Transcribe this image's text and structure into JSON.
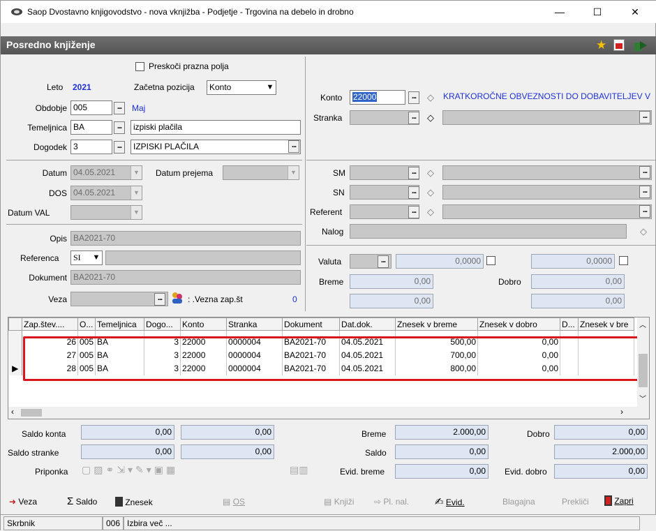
{
  "window": {
    "title": "Saop Dvostavno knjigovodstvo - nova vknjižba - Podjetje - Trgovina na debelo in drobno",
    "minimize": "—",
    "maximize": "☐",
    "close": "✕"
  },
  "header": {
    "title": "Posredno knjiženje"
  },
  "top_left": {
    "skip_empty_label": "Preskoči prazna polja",
    "year_label": "Leto",
    "year_value": "2021",
    "start_pos_label": "Začetna pozicija",
    "start_pos_value": "Konto",
    "period_label": "Obdobje",
    "period_value": "005",
    "period_name": "Maj",
    "doc_base_label": "Temeljnica",
    "doc_base_value": "BA",
    "doc_base_desc": "izpiski plačila",
    "event_label": "Dogodek",
    "event_value": "3",
    "event_desc": "IZPISKI PLAČILA"
  },
  "dates": {
    "date_label": "Datum",
    "date_value": "04.05.2021",
    "received_label": "Datum prejema",
    "received_value": "",
    "dos_label": "DOS",
    "dos_value": "04.05.2021",
    "val_label": "Datum VAL",
    "val_value": ""
  },
  "desc": {
    "opis_label": "Opis",
    "opis_value": "BA2021-70",
    "ref_label": "Referenca",
    "ref_code": "SI",
    "ref_value": "",
    "doc_label": "Dokument",
    "doc_value": "BA2021-70",
    "link_label": "Veza",
    "link_value": "",
    "link_num_label": ": .Vezna zap.št",
    "link_num_value": "0"
  },
  "right": {
    "konto_label": "Konto",
    "konto_value": "22000",
    "konto_desc": "KRATKOROČNE OBVEZNOSTI DO DOBAVITELJEV V",
    "stranka_label": "Stranka",
    "sm_label": "SM",
    "sn_label": "SN",
    "referent_label": "Referent",
    "nalog_label": "Nalog",
    "valuta_label": "Valuta",
    "valuta_amount1": "0,0000",
    "valuta_amount2": "0,0000",
    "breme_label": "Breme",
    "breme_value": "0,00",
    "breme_value2": "0,00",
    "dobro_label": "Dobro",
    "dobro_value": "0,00",
    "dobro_value2": "0,00"
  },
  "grid": {
    "columns": [
      "Zap.štev....",
      "O...",
      "Temeljnica",
      "Dogo...",
      "Konto",
      "Stranka",
      "Dokument",
      "Dat.dok.",
      "Znesek v breme",
      "Znesek v dobro",
      "D...",
      "Znesek v bre"
    ],
    "rows": [
      [
        "26",
        "005",
        "BA",
        "3",
        "22000",
        "0000004",
        "BA2021-70",
        "04.05.2021",
        "500,00",
        "0,00",
        "",
        ""
      ],
      [
        "27",
        "005",
        "BA",
        "3",
        "22000",
        "0000004",
        "BA2021-70",
        "04.05.2021",
        "700,00",
        "0,00",
        "",
        ""
      ],
      [
        "28",
        "005",
        "BA",
        "3",
        "22000",
        "0000004",
        "BA2021-70",
        "04.05.2021",
        "800,00",
        "0,00",
        "",
        ""
      ]
    ],
    "current_row_index": 2
  },
  "summary": {
    "saldo_konta_label": "Saldo konta",
    "saldo_konta_1": "0,00",
    "saldo_konta_2": "0,00",
    "saldo_stranke_label": "Saldo stranke",
    "saldo_stranke_1": "0,00",
    "saldo_stranke_2": "0,00",
    "priponka_label": "Priponka",
    "breme_label": "Breme",
    "breme_value": "2.000,00",
    "dobro_label": "Dobro",
    "dobro_value": "0,00",
    "saldo_label": "Saldo",
    "saldo_value": "0,00",
    "saldo_value2": "2.000,00",
    "evid_breme_label": "Evid. breme",
    "evid_breme_value": "0,00",
    "evid_dobro_label": "Evid. dobro",
    "evid_dobro_value": "0,00"
  },
  "toolbar": {
    "veza": "Veza",
    "saldo": "Saldo",
    "znesek": "Znesek",
    "os": "OS",
    "knjizi": "Knjiži",
    "pl_nal": "Pl. nal.",
    "evid": "Evid.",
    "blagajna": "Blagajna",
    "preklici": "Prekliči",
    "zapri": "Zapri"
  },
  "status": {
    "user": "Skrbnik",
    "code": "006",
    "text": "Izbira več ..."
  },
  "colors": {
    "highlight_border": "#d7161d",
    "accent_blue": "#1e2fd6"
  }
}
